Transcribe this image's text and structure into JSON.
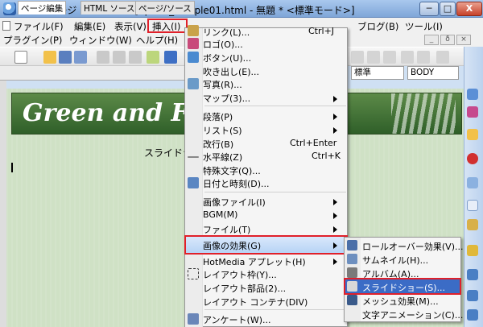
{
  "window": {
    "title": "ホームページ・ビルダー - [hpb08_sample01.html - 無題 * <標準モード>]",
    "minimize_label": "─",
    "maximize_label": "□",
    "close_label": "X"
  },
  "menubar": {
    "row1": [
      {
        "label": "ファイル(F)"
      },
      {
        "label": "編集(E)"
      },
      {
        "label": "表示(V)"
      },
      {
        "label": "挿入(I)"
      },
      {
        "label": "ブログ(B)"
      },
      {
        "label": "ツール(I)"
      }
    ],
    "row2": [
      {
        "label": "プラグイン(P)"
      },
      {
        "label": "ウィンドウ(W)"
      },
      {
        "label": "ヘルプ(H)"
      }
    ],
    "mdi_min": "_",
    "mdi_restore": "ð",
    "mdi_close": "×"
  },
  "tabs": [
    {
      "label": "ページ編集"
    },
    {
      "label": "HTML ソース"
    },
    {
      "label": "ページ/ソース"
    }
  ],
  "combos": {
    "style": "標準",
    "tag": "BODY"
  },
  "canvas": {
    "banner_title": "Green and Flo",
    "text": "スライドシ"
  },
  "insert_menu": {
    "items": [
      {
        "label": "リンク(L)...",
        "shortcut": "Ctrl+J"
      },
      {
        "label": "ロゴ(O)..."
      },
      {
        "label": "ボタン(U)..."
      },
      {
        "label": "吹き出し(E)..."
      },
      {
        "label": "写真(R)..."
      },
      {
        "label": "マップ(3)..."
      },
      {
        "label": "段落(P)"
      },
      {
        "label": "リスト(S)"
      },
      {
        "label": "改行(B)",
        "shortcut": "Ctrl+Enter"
      },
      {
        "label": "水平線(Z)",
        "shortcut": "Ctrl+K"
      },
      {
        "label": "特殊文字(Q)..."
      },
      {
        "label": "日付と時刻(D)..."
      },
      {
        "label": "画像ファイル(I)"
      },
      {
        "label": "BGM(M)"
      },
      {
        "label": "ファイル(T)"
      },
      {
        "label": "画像の効果(G)"
      },
      {
        "label": "HotMedia アプレット(H)"
      },
      {
        "label": "レイアウト枠(Y)..."
      },
      {
        "label": "レイアウト部品(2)..."
      },
      {
        "label": "レイアウト コンテナ(DIV)"
      },
      {
        "label": "アンケート(W)..."
      }
    ]
  },
  "effects_submenu": {
    "items": [
      {
        "label": "ロールオーバー効果(V)..."
      },
      {
        "label": "サムネイル(H)..."
      },
      {
        "label": "アルバム(A)..."
      },
      {
        "label": "スライドショー(S)..."
      },
      {
        "label": "メッシュ効果(M)..."
      },
      {
        "label": "文字アニメーション(C)..."
      }
    ]
  },
  "colors": {
    "highlight_frame": "#e0202a",
    "selection": "#3b6cc6",
    "banner": "#2f5f29"
  }
}
